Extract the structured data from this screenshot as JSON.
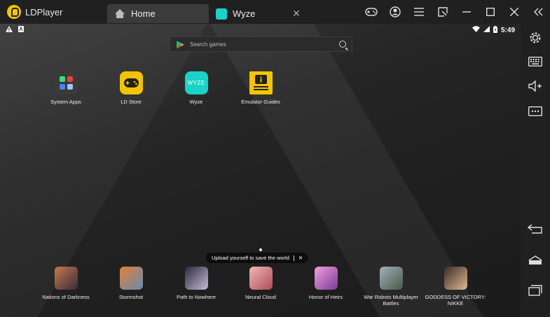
{
  "titlebar": {
    "app_name": "LDPlayer",
    "tabs": [
      {
        "label": "Home",
        "icon": "home-icon",
        "active": true
      },
      {
        "label": "Wyze",
        "icon": "wyze-icon",
        "active": false,
        "close": "✕"
      }
    ],
    "icons": [
      "gamepad-icon",
      "account-icon",
      "menu-icon",
      "screen-record-icon",
      "minimize-icon",
      "maximize-icon",
      "close-icon",
      "collapse-sidebar-icon"
    ]
  },
  "statusbar": {
    "left_icons": [
      "warning-icon",
      "notification-icon"
    ],
    "right_icons": [
      "wifi-icon",
      "signal-icon",
      "battery-icon"
    ],
    "time": "5:49"
  },
  "search": {
    "placeholder": "Search games"
  },
  "apps": [
    {
      "label": "System Apps",
      "icon": "system-apps-icon"
    },
    {
      "label": "LD Store",
      "icon": "ld-store-icon"
    },
    {
      "label": "Wyze",
      "icon": "wyze-app-icon",
      "icon_text": "WYZE"
    },
    {
      "label": "Emulator Guides",
      "icon": "emulator-guides-icon"
    }
  ],
  "games": [
    {
      "label": "Nations of Darkness",
      "color": "#7a4a3a"
    },
    {
      "label": "Stormshot",
      "color": "#b85a2a"
    },
    {
      "label": "Path to Nowhere",
      "color": "#5a4a6a"
    },
    {
      "label": "Neural Cloud",
      "color": "#c98a8a"
    },
    {
      "label": "Honor of Heirs",
      "color": "#c46ab0"
    },
    {
      "label": "War Robots Multiplayer Battles",
      "color": "#6a7a6a"
    },
    {
      "label": "GODDESS OF VICTORY: NIKKE",
      "color": "#8a6a5a"
    }
  ],
  "toast": {
    "text": "Upload yourself to save the world",
    "close": "✕"
  },
  "sidebar": {
    "icons": [
      "settings-icon",
      "keyboard-icon",
      "volume-up-icon",
      "more-icon",
      "back-icon",
      "home-nav-icon",
      "recents-icon"
    ]
  },
  "colors": {
    "accent": "#f5c400",
    "wyze": "#1ad2c8",
    "titlebar": "#202020",
    "active_tab": "#3b3b3b"
  }
}
